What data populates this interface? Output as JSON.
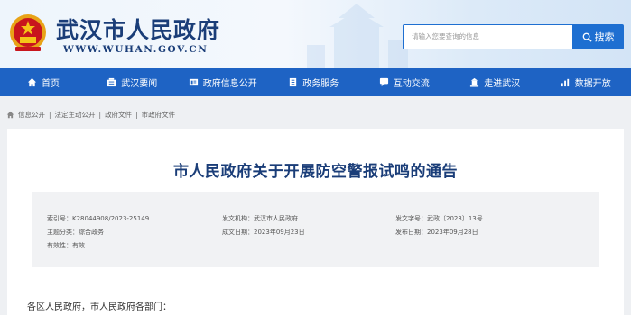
{
  "header": {
    "site_name": "武汉市人民政府",
    "site_url": "WWW.WUHAN.GOV.CN",
    "search_placeholder": "请输入您要查询的信息",
    "search_button": "搜索"
  },
  "nav": [
    {
      "label": "首页",
      "icon": "home-icon"
    },
    {
      "label": "武汉要闻",
      "icon": "news-icon"
    },
    {
      "label": "政府信息公开",
      "icon": "info-icon"
    },
    {
      "label": "政务服务",
      "icon": "service-icon"
    },
    {
      "label": "互动交流",
      "icon": "chat-icon"
    },
    {
      "label": "走进武汉",
      "icon": "building-icon"
    },
    {
      "label": "数据开放",
      "icon": "chart-icon"
    }
  ],
  "breadcrumb": [
    "信息公开",
    "法定主动公开",
    "政府文件",
    "市政府文件"
  ],
  "article": {
    "title": "市人民政府关于开展防空警报试鸣的通告",
    "meta": {
      "index_label": "索引号：",
      "index_value": "K28044908/2023-25149",
      "topic_label": "主题分类：",
      "topic_value": "综合政务",
      "validity_label": "有效性：",
      "validity_value": "有效",
      "issuer_label": "发文机构：",
      "issuer_value": "武汉市人民政府",
      "written_label": "成文日期：",
      "written_value": "2023年09月23日",
      "docno_label": "发文字号：",
      "docno_value": "武政〔2023〕13号",
      "published_label": "发布日期：",
      "published_value": "2023年09月28日"
    },
    "salutation": "各区人民政府，市人民政府各部门："
  },
  "colors": {
    "nav_bg": "#1e63c4",
    "title": "#1a3d78",
    "accent": "#1e6fd1"
  }
}
